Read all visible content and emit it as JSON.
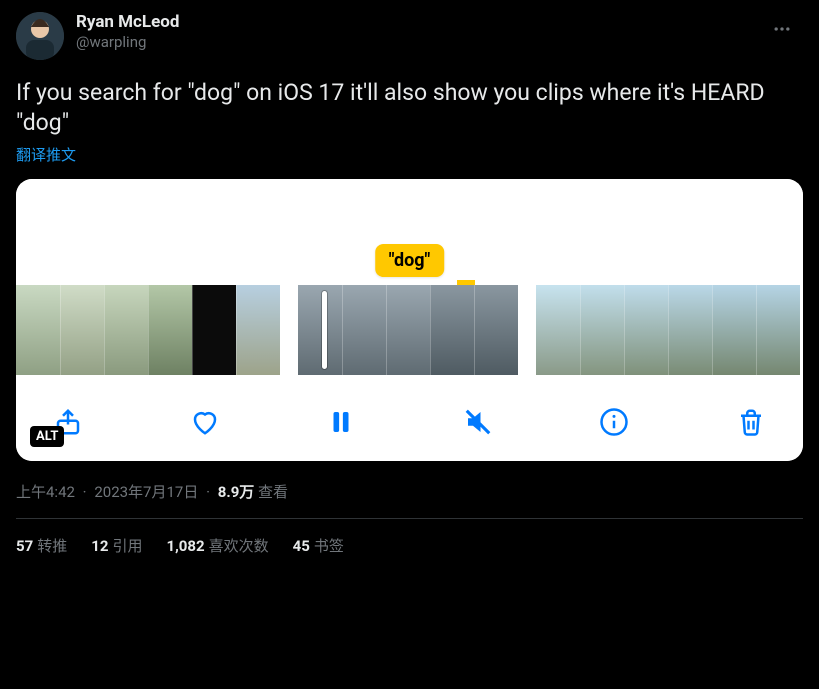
{
  "author": {
    "display_name": "Ryan McLeod",
    "handle": "@warpling"
  },
  "tweet_text": "If you search for \"dog\" on iOS 17 it'll also show you clips where it's HEARD \"dog\"",
  "translate_label": "翻译推文",
  "media": {
    "caption_badge": "\"dog\"",
    "alt_badge": "ALT",
    "toolbar_icons": {
      "share": "share-icon",
      "like": "heart-icon",
      "pause": "pause-icon",
      "mute": "mute-icon",
      "info": "info-icon",
      "trash": "trash-icon"
    }
  },
  "meta": {
    "time": "上午4:42",
    "date": "2023年7月17日",
    "views_number": "8.9万",
    "views_label": "查看"
  },
  "stats": {
    "retweets": {
      "count": "57",
      "label": "转推"
    },
    "quotes": {
      "count": "12",
      "label": "引用"
    },
    "likes": {
      "count": "1,082",
      "label": "喜欢次数"
    },
    "bookmarks": {
      "count": "45",
      "label": "书签"
    }
  }
}
